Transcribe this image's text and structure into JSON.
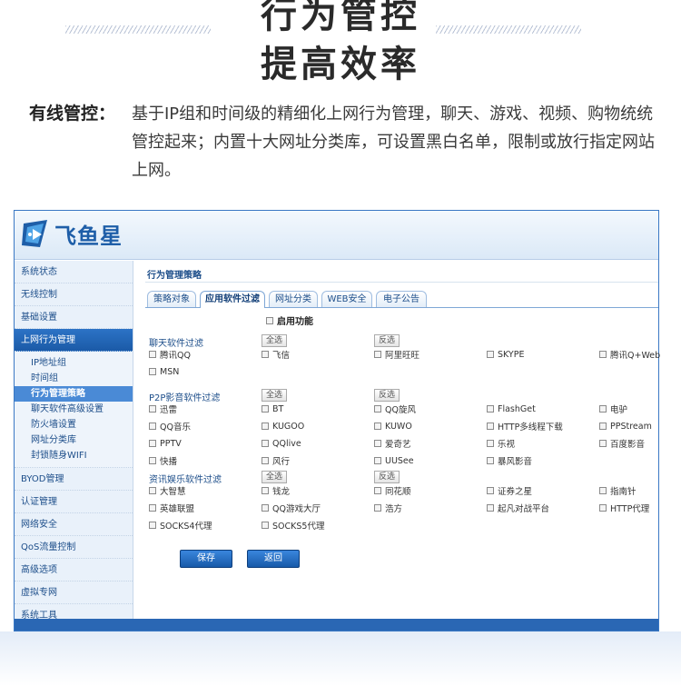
{
  "hero": {
    "title_line1": "行为管控",
    "title_line2": "提高效率"
  },
  "feature": {
    "label": "有线管控：",
    "text": "基于IP组和时间级的精细化上网行为管理，聊天、游戏、视频、购物统统管控起来；内置十大网址分类库，可设置黑白名单，限制或放行指定网站上网。"
  },
  "app": {
    "brand": "飞鱼星",
    "brand_color": "#1e5ea8",
    "sidebar": {
      "top_items": [
        "系统状态",
        "无线控制",
        "基础设置"
      ],
      "active_group": "上网行为管理",
      "sub_items": [
        "IP地址组",
        "时间组",
        "行为管理策略",
        "聊天软件高级设置",
        "防火墙设置",
        "网址分类库",
        "封锁随身WIFI"
      ],
      "active_sub": "行为管理策略",
      "bottom_items": [
        "BYOD管理",
        "认证管理",
        "网络安全",
        "QoS流量控制",
        "高级选项",
        "虚拟专网",
        "系统工具"
      ]
    },
    "page_title": "行为管理策略",
    "tabs": [
      "策略对象",
      "应用软件过滤",
      "网址分类",
      "WEB安全",
      "电子公告"
    ],
    "active_tab": "应用软件过滤",
    "enable_label": "启用功能",
    "select_all": "全选",
    "invert": "反选",
    "sections": [
      {
        "title": "聊天软件过滤",
        "options": [
          "腾讯QQ",
          "飞信",
          "阿里旺旺",
          "SKYPE",
          "腾讯Q+Web",
          "MSN"
        ]
      },
      {
        "title": "P2P影音软件过滤",
        "options": [
          "迅雷",
          "BT",
          "QQ旋风",
          "FlashGet",
          "电驴",
          "QQ音乐",
          "KUGOO",
          "KUWO",
          "HTTP多线程下载",
          "PPStream",
          "PPTV",
          "QQlive",
          "爱奇艺",
          "乐视",
          "百度影音",
          "快播",
          "风行",
          "UUSee",
          "暴风影音"
        ]
      },
      {
        "title": "资讯娱乐软件过滤",
        "options": [
          "大智慧",
          "钱龙",
          "同花顺",
          "证券之星",
          "指南针",
          "英雄联盟",
          "QQ游戏大厅",
          "浩方",
          "起凡对战平台",
          "HTTP代理",
          "SOCKS4代理",
          "SOCKS5代理"
        ]
      }
    ],
    "save_label": "保存",
    "back_label": "返回"
  }
}
